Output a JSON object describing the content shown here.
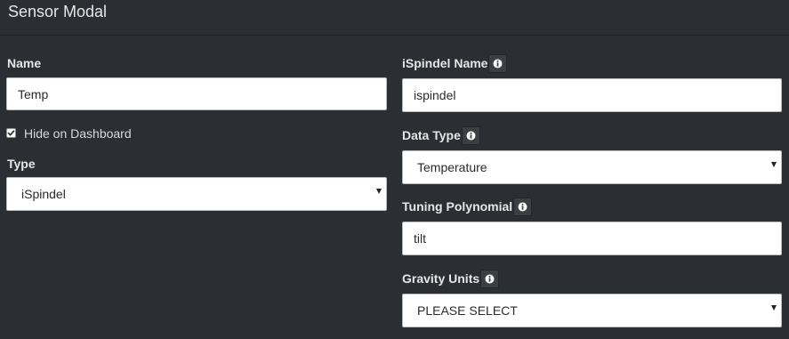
{
  "modal": {
    "title": "Sensor Modal"
  },
  "left": {
    "name": {
      "label": "Name",
      "value": "Temp"
    },
    "hide_on_dashboard": {
      "label": "Hide on Dashboard",
      "checked": true
    },
    "type": {
      "label": "Type",
      "value": "iSpindel"
    }
  },
  "right": {
    "ispindel_name": {
      "label": "iSpindel Name",
      "value": "ispindel"
    },
    "data_type": {
      "label": "Data Type",
      "value": "Temperature"
    },
    "tuning_polynomial": {
      "label": "Tuning Polynomial",
      "value": "tilt"
    },
    "gravity_units": {
      "label": "Gravity Units",
      "value": "PLEASE SELECT"
    }
  },
  "icons": {
    "info": "info-icon",
    "check": "check-icon",
    "caret": "caret-down-icon"
  }
}
